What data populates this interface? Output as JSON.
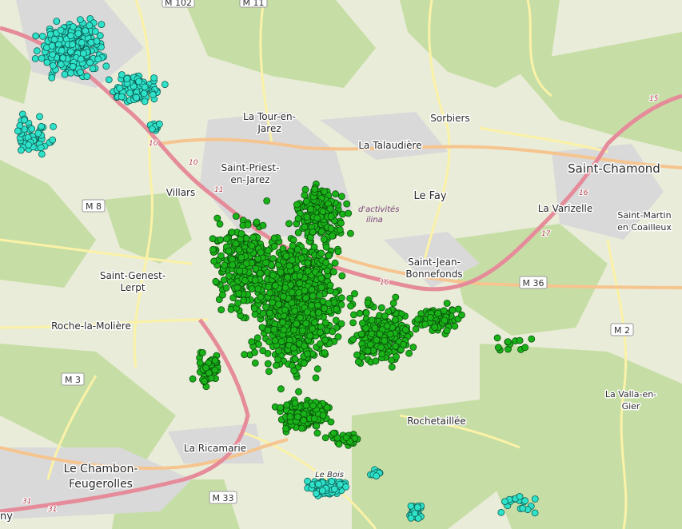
{
  "map": {
    "places": {
      "tour_en_jarez_1": "La Tour-en-",
      "tour_en_jarez_2": "Jarez",
      "sorbiers": "Sorbiers",
      "la_talaudiere": "La Talaudière",
      "saint_priest_1": "Saint-Priest-",
      "saint_priest_2": "en-Jarez",
      "villars": "Villars",
      "le_fay": "Le Fay",
      "saint_chamond": "Saint-Chamond",
      "la_varizelle": "La Varizelle",
      "saint_martin_1": "Saint-Martin",
      "saint_martin_2": "en Coailleux",
      "saint_jean_1": "Saint-Jean-",
      "saint_jean_2": "Bonnefonds",
      "saint_genest_1": "Saint-Genest-",
      "saint_genest_2": "Lerpt",
      "roche_la_moliere": "Roche-la-Molière",
      "rochetaillee": "Rochetaillée",
      "la_valla_1": "La Valla-en-",
      "la_valla_2": "Gier",
      "la_ricamarie": "La Ricamarie",
      "le_chambon_1": "Le Chambon-",
      "le_chambon_2": "Feugerolles",
      "le_bois": "Le Bois",
      "parc_activites_1": "d'activités",
      "parc_activites_2": "ilina",
      "edge_ny": "ny"
    },
    "road_shields": {
      "m102": "M 102",
      "m11": "M 11",
      "m8": "M 8",
      "m36": "M 36",
      "m2": "M 2",
      "m3": "M 3",
      "m33": "M 33"
    },
    "exits": {
      "e10a": "10",
      "e10b": "10",
      "e11": "11",
      "e15": "15",
      "e16a": "16",
      "e16b": "16",
      "e17": "17",
      "e31a": "31",
      "e31b": "31"
    },
    "colors": {
      "background": "#e9ecd8",
      "forest": "#c6dea5",
      "urban": "#d9d9d9",
      "motorway": "#e58b9a",
      "trunk": "#f6c48e",
      "minor_road": "#fbf2a7",
      "green_points": "#19b319",
      "green_point_stroke": "#0b4d0b",
      "cyan_points": "#2ee2c9",
      "cyan_point_stroke": "#0e5f55"
    }
  }
}
